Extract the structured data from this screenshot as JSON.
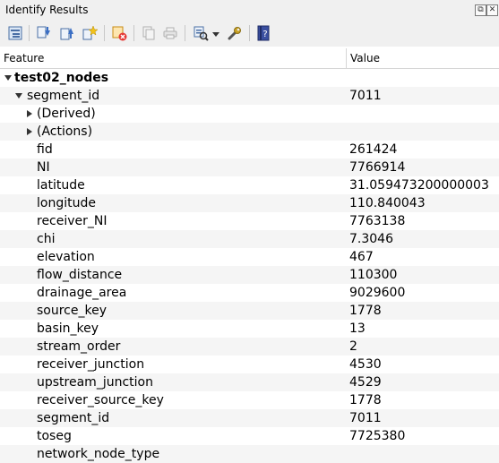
{
  "panel": {
    "title": "Identify Results",
    "float_button": "⧉",
    "close_button": "✕"
  },
  "toolbar": {
    "icons": [
      "expand-tree-icon",
      "expand-all-icon",
      "collapse-all-icon",
      "expand-new-icon",
      "clear-results-icon",
      "copy-feature-icon",
      "print-icon",
      "identify-mode-icon",
      "identify-mode-dropdown-icon",
      "settings-icon",
      "help-icon"
    ]
  },
  "table": {
    "headers": {
      "feature": "Feature",
      "value": "Value"
    },
    "layer": "test02_nodes",
    "feature_field": "segment_id",
    "feature_value": "7011",
    "derived": "(Derived)",
    "actions": "(Actions)",
    "attributes": [
      {
        "name": "fid",
        "value": "261424"
      },
      {
        "name": "NI",
        "value": "7766914"
      },
      {
        "name": "latitude",
        "value": "31.059473200000003"
      },
      {
        "name": "longitude",
        "value": "110.840043"
      },
      {
        "name": "receiver_NI",
        "value": "7763138"
      },
      {
        "name": "chi",
        "value": "7.3046"
      },
      {
        "name": "elevation",
        "value": "467"
      },
      {
        "name": "flow_distance",
        "value": "110300"
      },
      {
        "name": "drainage_area",
        "value": "9029600"
      },
      {
        "name": "source_key",
        "value": "1778"
      },
      {
        "name": "basin_key",
        "value": "13"
      },
      {
        "name": "stream_order",
        "value": "2"
      },
      {
        "name": "receiver_junction",
        "value": "4530"
      },
      {
        "name": "upstream_junction",
        "value": "4529"
      },
      {
        "name": "receiver_source_key",
        "value": "1778"
      },
      {
        "name": "segment_id",
        "value": "7011"
      },
      {
        "name": "toseg",
        "value": "7725380"
      },
      {
        "name": "network_node_type",
        "value": ""
      }
    ]
  }
}
